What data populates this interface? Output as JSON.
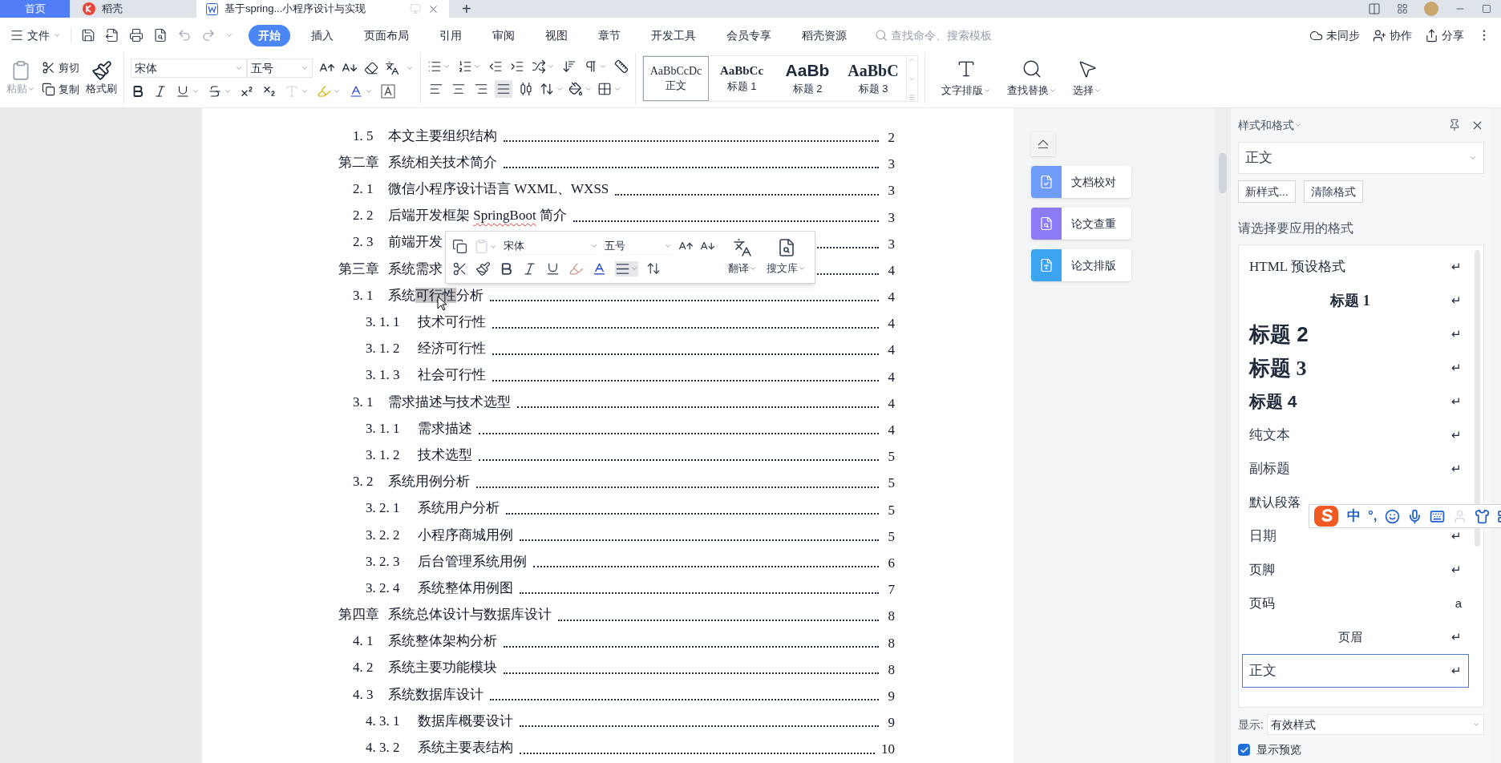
{
  "title_bar": {
    "tabs": [
      {
        "label": "首页",
        "kind": "home",
        "selected": false
      },
      {
        "label": "稻壳",
        "kind": "docer",
        "selected": false
      },
      {
        "label": "基于spring...小程序设计与实现",
        "kind": "doc",
        "selected": true
      }
    ],
    "new_tab": "+"
  },
  "menu_bar": {
    "file": "文件",
    "tabs": [
      {
        "label": "开始",
        "selected": true
      },
      {
        "label": "插入",
        "selected": false
      },
      {
        "label": "页面布局",
        "selected": false
      },
      {
        "label": "引用",
        "selected": false
      },
      {
        "label": "审阅",
        "selected": false
      },
      {
        "label": "视图",
        "selected": false
      },
      {
        "label": "章节",
        "selected": false
      },
      {
        "label": "开发工具",
        "selected": false
      },
      {
        "label": "会员专享",
        "selected": false
      },
      {
        "label": "稻壳资源",
        "selected": false
      }
    ],
    "search": {
      "placeholder": "查找命令、搜索模板"
    },
    "actions": [
      {
        "label": "未同步",
        "kind": "sync"
      },
      {
        "label": "协作",
        "kind": "collab"
      },
      {
        "label": "分享",
        "kind": "share"
      }
    ]
  },
  "ribbon": {
    "paste": {
      "label": "粘贴",
      "disabled": true
    },
    "cut": "剪切",
    "copy": "复制",
    "format_painter": "格式刷",
    "font": "宋体",
    "size": "五号",
    "alignment": [
      {
        "kind": "left",
        "selected": false
      },
      {
        "kind": "center",
        "selected": false
      },
      {
        "kind": "right",
        "selected": false
      },
      {
        "kind": "justify",
        "selected": true
      },
      {
        "kind": "distributed",
        "selected": false
      }
    ],
    "styles": [
      {
        "preview": "AaBbCcDc",
        "label": "正文",
        "kind": "normal",
        "selected": true
      },
      {
        "preview": "AaBbCc",
        "label": "标题 1",
        "kind": "h1",
        "selected": false
      },
      {
        "preview": "AaBb",
        "label": "标题 2",
        "kind": "h2",
        "selected": false
      },
      {
        "preview": "AaBbC",
        "label": "标题 3",
        "kind": "h3",
        "selected": false
      }
    ],
    "tools": [
      {
        "label": "文字排版",
        "kind": "typeset"
      },
      {
        "label": "查找替换",
        "kind": "find"
      },
      {
        "label": "选择",
        "kind": "select"
      }
    ]
  },
  "document": {
    "toc": [
      {
        "number": "1. 5",
        "title": "本文主要组织结构",
        "page": "2",
        "kind": "section"
      },
      {
        "number": "第二章",
        "title": "系统相关技术简介",
        "page": "3",
        "kind": "chapter",
        "children": [
          {
            "number": "2. 1",
            "title": "微信小程序设计语言 WXML、WXSS",
            "page": "3",
            "kind": "section"
          },
          {
            "number": "2. 2",
            "parts": [
              {
                "text": "后端开发框架 ",
                "kind": "plain"
              },
              {
                "text": "SpringBoot",
                "kind": "misspelled"
              },
              {
                "text": " 简介",
                "kind": "plain"
              }
            ],
            "page": "3",
            "kind": "section"
          },
          {
            "number": "2. 3",
            "title": "前端开发",
            "page": "3",
            "kind": "section"
          }
        ]
      },
      {
        "number": "第三章",
        "title": "系统需求",
        "page": "4",
        "kind": "chapter",
        "children": [
          {
            "number": "3. 1",
            "parts": [
              {
                "text": "系统",
                "kind": "plain"
              },
              {
                "text": "可行性",
                "kind": "selected"
              },
              {
                "text": "分析",
                "kind": "plain"
              }
            ],
            "page": "4",
            "kind": "section",
            "children": [
              {
                "number": "3. 1. 1",
                "title": "技术可行性",
                "page": "4",
                "kind": "subsection"
              },
              {
                "number": "3. 1. 2",
                "title": "经济可行性",
                "page": "4",
                "kind": "subsection"
              },
              {
                "number": "3. 1. 3",
                "title": "社会可行性",
                "page": "4",
                "kind": "subsection"
              }
            ]
          },
          {
            "number": "3. 1",
            "title": "需求描述与技术选型",
            "page": "4",
            "kind": "section",
            "children": [
              {
                "number": "3. 1. 1",
                "title": "需求描述",
                "page": "4",
                "kind": "subsection"
              },
              {
                "number": "3. 1. 2",
                "title": "技术选型",
                "page": "5",
                "kind": "subsection"
              }
            ]
          },
          {
            "number": "3. 2",
            "title": "系统用例分析",
            "page": "5",
            "kind": "section",
            "children": [
              {
                "number": "3. 2. 1",
                "title": "系统用户分析",
                "page": "5",
                "kind": "subsection"
              },
              {
                "number": "3. 2. 2",
                "title": "小程序商城用例",
                "page": "5",
                "kind": "subsection"
              },
              {
                "number": "3. 2. 3",
                "title": "后台管理系统用例",
                "page": "6",
                "kind": "subsection"
              },
              {
                "number": "3. 2. 4",
                "title": "系统整体用例图",
                "page": "7",
                "kind": "subsection"
              }
            ]
          }
        ]
      },
      {
        "number": "第四章",
        "title": "系统总体设计与数据库设计",
        "page": "8",
        "kind": "chapter",
        "children": [
          {
            "number": "4. 1",
            "title": "系统整体架构分析",
            "page": "8",
            "kind": "section"
          },
          {
            "number": "4. 2",
            "title": "系统主要功能模块",
            "page": "8",
            "kind": "section"
          },
          {
            "number": "4. 3",
            "title": "系统数据库设计",
            "page": "9",
            "kind": "section",
            "children": [
              {
                "number": "4. 3. 1",
                "title": "数据库概要设计",
                "page": "9",
                "kind": "subsection"
              },
              {
                "number": "4. 3. 2",
                "title": "系统主要表结构",
                "page": "10",
                "kind": "subsection"
              }
            ]
          }
        ]
      }
    ]
  },
  "mini_toolbar": {
    "font": "宋体",
    "size": "五号",
    "translate": "翻译",
    "search_library": "搜文库",
    "paste_disabled": true,
    "align_active": true
  },
  "side_tools": [
    {
      "label": "文档校对",
      "color": "#6f9cf8",
      "kind": "proofread"
    },
    {
      "label": "论文查重",
      "color": "#8b7cf6",
      "kind": "plagiarism"
    },
    {
      "label": "论文排版",
      "color": "#3aa4f0",
      "kind": "layout"
    }
  ],
  "styles_panel": {
    "title": "样式和格式",
    "current": "正文",
    "buttons": [
      "新样式...",
      "清除格式"
    ],
    "prompt": "请选择要应用的格式",
    "items": [
      {
        "label": "HTML 预设格式",
        "kind": "html",
        "marker": "↵",
        "selected": false
      },
      {
        "label": "标题 1",
        "kind": "heading1",
        "marker": "↵",
        "selected": false
      },
      {
        "label": "标题 2",
        "kind": "heading2",
        "marker": "↵",
        "selected": false
      },
      {
        "label": "标题 3",
        "kind": "heading3",
        "marker": "↵",
        "selected": false
      },
      {
        "label": "标题 4",
        "kind": "heading4",
        "marker": "↵",
        "selected": false
      },
      {
        "label": "纯文本",
        "kind": "serif",
        "marker": "↵",
        "selected": false
      },
      {
        "label": "副标题",
        "kind": "serif",
        "marker": "↵",
        "selected": false
      },
      {
        "label": "默认段落",
        "kind": "plain",
        "selected": false
      },
      {
        "label": "日期",
        "kind": "serif",
        "marker": "↵",
        "selected": false
      },
      {
        "label": "页脚",
        "kind": "plain",
        "marker": "↵",
        "selected": false
      },
      {
        "label": "页码",
        "kind": "plain",
        "marker": "a",
        "selected": false
      },
      {
        "label": "页眉",
        "kind": "centered",
        "marker": "↵",
        "selected": false
      },
      {
        "label": "正文",
        "kind": "serif",
        "marker": "↵",
        "selected": true
      }
    ],
    "show_label": "显示:",
    "show_value": "有效样式",
    "preview": {
      "label": "显示预览",
      "checked": true
    }
  },
  "ime_bar": {
    "labels": [
      "中",
      "°,"
    ]
  }
}
